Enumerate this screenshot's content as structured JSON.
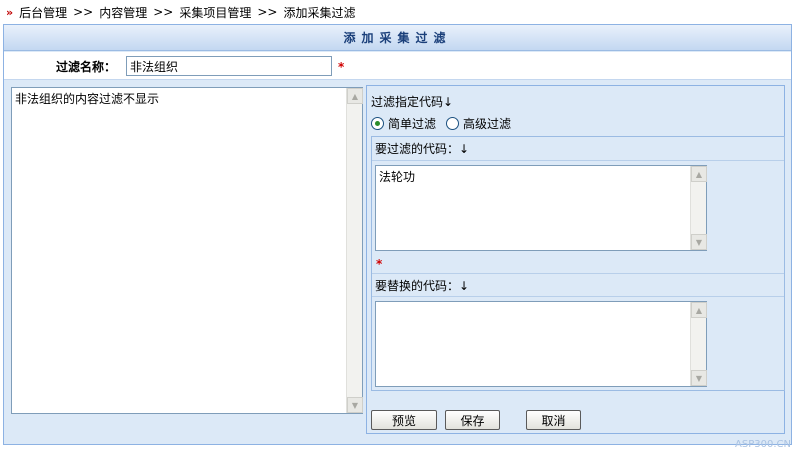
{
  "breadcrumb": {
    "items": [
      "后台管理",
      "内容管理",
      "采集项目管理",
      "添加采集过滤"
    ],
    "separator": ">>"
  },
  "form": {
    "title": "添加采集过滤",
    "name_label": "过滤名称：",
    "name_value": "非法组织",
    "required_mark": "*",
    "description_value": "非法组织的内容过滤不显示"
  },
  "filter_panel": {
    "label": "过滤指定代码↓",
    "modes": [
      {
        "label": "简单过滤",
        "selected": true
      },
      {
        "label": "高级过滤",
        "selected": false
      }
    ],
    "filter_code_label": "要过滤的代码：↓",
    "filter_code_value": "法轮功",
    "replace_code_label": "要替换的代码：↓",
    "replace_code_value": ""
  },
  "buttons": {
    "preview": "预览",
    "save": "保存",
    "cancel": "取消"
  },
  "watermark": "ASP300.CN",
  "colors": {
    "panel_bg": "#dce9f7",
    "border": "#8db2e3",
    "title_text": "#1a3f7a",
    "required": "#d00000",
    "breadcrumb_arrow": "#c00000"
  }
}
